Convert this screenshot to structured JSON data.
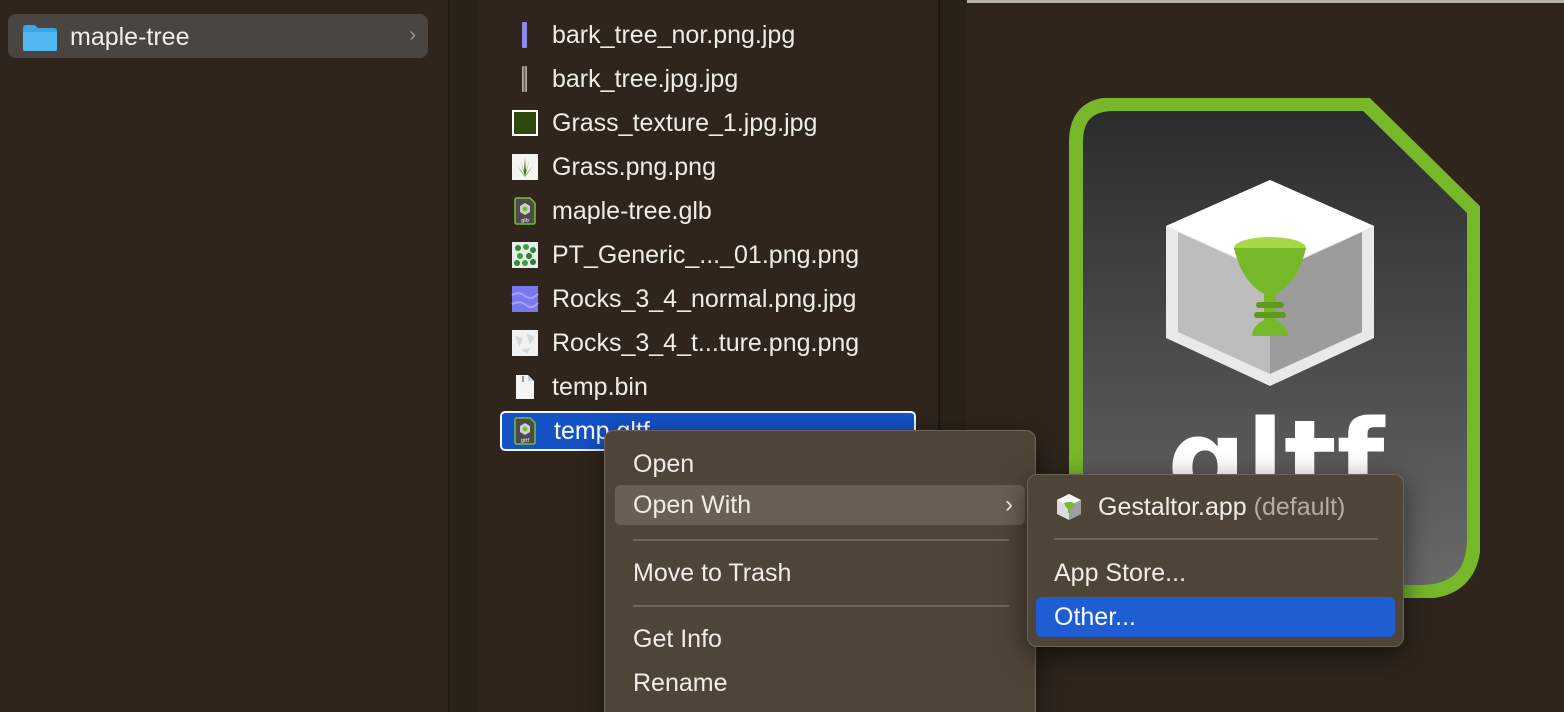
{
  "sidebar": {
    "folder": {
      "label": "maple-tree",
      "icon": "folder-icon",
      "chevron": "›"
    }
  },
  "files": [
    {
      "name": "bark_tree_nor.png.jpg",
      "icon": "bark-normal-thumbnail-icon"
    },
    {
      "name": "bark_tree.jpg.jpg",
      "icon": "bark-thumbnail-icon"
    },
    {
      "name": "Grass_texture_1.jpg.jpg",
      "icon": "grass-texture-thumbnail-icon"
    },
    {
      "name": "Grass.png.png",
      "icon": "grass-thumbnail-icon"
    },
    {
      "name": "maple-tree.glb",
      "icon": "glb-file-icon"
    },
    {
      "name": "PT_Generic_..._01.png.png",
      "icon": "leaves-thumbnail-icon"
    },
    {
      "name": "Rocks_3_4_normal.png.jpg",
      "icon": "rocks-normal-thumbnail-icon"
    },
    {
      "name": "Rocks_3_4_t...ture.png.png",
      "icon": "rocks-texture-thumbnail-icon"
    },
    {
      "name": "temp.bin",
      "icon": "document-icon"
    },
    {
      "name": "temp.gltf",
      "icon": "gltf-file-icon",
      "selected": true
    }
  ],
  "context_menu": {
    "items": [
      {
        "label": "Open"
      },
      {
        "label": "Open With",
        "has_submenu": true,
        "chevron": "›"
      },
      {
        "label": "Move to Trash"
      },
      {
        "label": "Get Info"
      },
      {
        "label": "Rename"
      }
    ]
  },
  "submenu": {
    "default_app": {
      "name": "Gestaltor.app",
      "suffix": "(default)",
      "icon": "gestaltor-app-icon"
    },
    "app_store": "App Store...",
    "other": "Other..."
  },
  "preview": {
    "icon": "gltf-large-preview-icon",
    "text": "gltf"
  },
  "colors": {
    "selection": "#1552c6",
    "menu_highlight": "#1e5ed2",
    "gltf_green": "#76b82a",
    "folder_blue": "#3da4e6"
  }
}
